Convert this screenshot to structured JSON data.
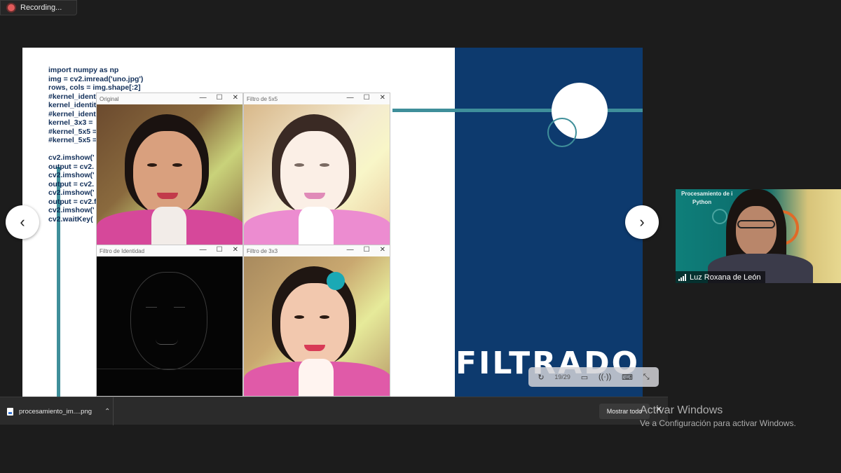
{
  "recording": {
    "label": "Recording..."
  },
  "slide": {
    "title": "FILTRADO",
    "code_lines": [
      "import numpy as np",
      "img = cv2.imread('uno.jpg')",
      "rows, cols = img.shape[:2]",
      "#kernel_ident",
      "kernel_identit",
      "#kernel_ident",
      "kernel_3x3 =",
      "#kernel_5x5 =",
      "#kernel_5x5 =",
      "",
      "cv2.imshow('",
      "output = cv2.",
      "cv2.imshow('",
      "output = cv2.",
      "cv2.imshow('",
      "output = cv2.f",
      "cv2.imshow('",
      "cv2.waitKey("
    ],
    "windows": {
      "original": "Original",
      "filtro5x5": "Filtro de 5x5",
      "identidad": "Filtro de Identidad",
      "filtro3x3": "Filtro de 3x3"
    },
    "win_controls": {
      "minimize": "—",
      "maximize": "☐",
      "close": "✕"
    }
  },
  "navigation": {
    "prev": "‹",
    "next": "›"
  },
  "presenter_toolbar": {
    "page_counter": "19/29"
  },
  "participant": {
    "name": "Luz Roxana de León",
    "bg_text_1": "Procesamiento de i",
    "bg_text_2": "Python"
  },
  "download_bar": {
    "filename": "procesamiento_im....png",
    "show_all": "Mostrar todo"
  },
  "windows_activation": {
    "title": "Activar Windows",
    "subtitle": "Ve a Configuración para activar Windows."
  },
  "colors": {
    "slide_blue": "#0d3a6e",
    "teal": "#3f8f9a",
    "cursor_highlight": "#1ba9b5"
  }
}
